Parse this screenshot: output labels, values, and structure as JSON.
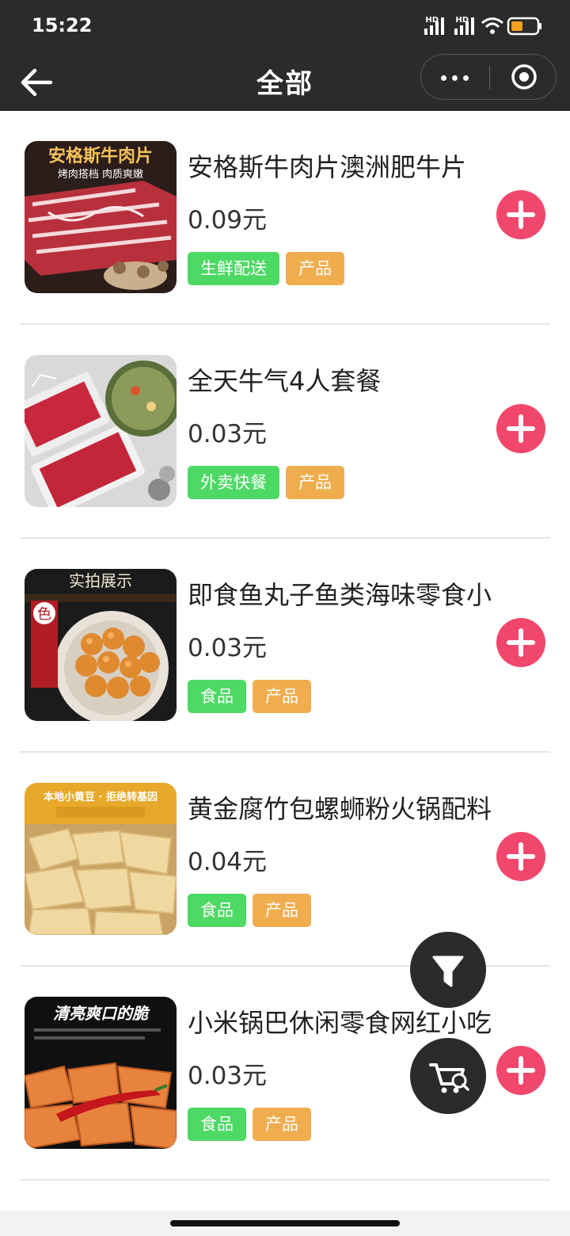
{
  "status_bar": {
    "time": "15:22",
    "signal_labels": [
      "HD",
      "HD"
    ],
    "icons": [
      "signal-hd-icon",
      "signal-hd-icon",
      "wifi-icon",
      "battery-icon"
    ]
  },
  "nav": {
    "title": "全部",
    "back_icon": "arrow-left-icon",
    "menu_icons": [
      "more-dots-icon",
      "target-close-icon"
    ]
  },
  "products": [
    {
      "name": "安格斯牛肉片澳洲肥牛片",
      "price": "0.09元",
      "tags": [
        {
          "label": "生鲜配送",
          "color": "green"
        },
        {
          "label": "产品",
          "color": "orange"
        }
      ],
      "image_caption": {
        "title": "安格斯牛肉片",
        "subtitle": "烤肉搭档  肉质爽嫩"
      }
    },
    {
      "name": "全天牛气4人套餐",
      "price": "0.03元",
      "tags": [
        {
          "label": "外卖快餐",
          "color": "green"
        },
        {
          "label": "产品",
          "color": "orange"
        }
      ],
      "image_caption": {
        "title": "",
        "subtitle": ""
      }
    },
    {
      "name": "即食鱼丸子鱼类海味零食小",
      "price": "0.03元",
      "tags": [
        {
          "label": "食品",
          "color": "green"
        },
        {
          "label": "产品",
          "color": "orange"
        }
      ],
      "image_caption": {
        "title": "实拍展示",
        "subtitle": "色"
      }
    },
    {
      "name": "黄金腐竹包螺蛳粉火锅配料",
      "price": "0.04元",
      "tags": [
        {
          "label": "食品",
          "color": "green"
        },
        {
          "label": "产品",
          "color": "orange"
        }
      ],
      "image_caption": {
        "title": "本地小黄豆 · 拒绝转基因",
        "subtitle": ""
      }
    },
    {
      "name": "小米锅巴休闲零食网红小吃",
      "price": "0.03元",
      "tags": [
        {
          "label": "食品",
          "color": "green"
        },
        {
          "label": "产品",
          "color": "orange"
        }
      ],
      "image_caption": {
        "title": "清亮爽口的脆",
        "subtitle": ""
      }
    }
  ],
  "floating_buttons": [
    "filter-icon",
    "cart-search-icon"
  ],
  "colors": {
    "header_bg": "#2b2b2b",
    "tag_green": "#4cd964",
    "tag_orange": "#f0ad4e",
    "add_button": "#f2476c"
  }
}
